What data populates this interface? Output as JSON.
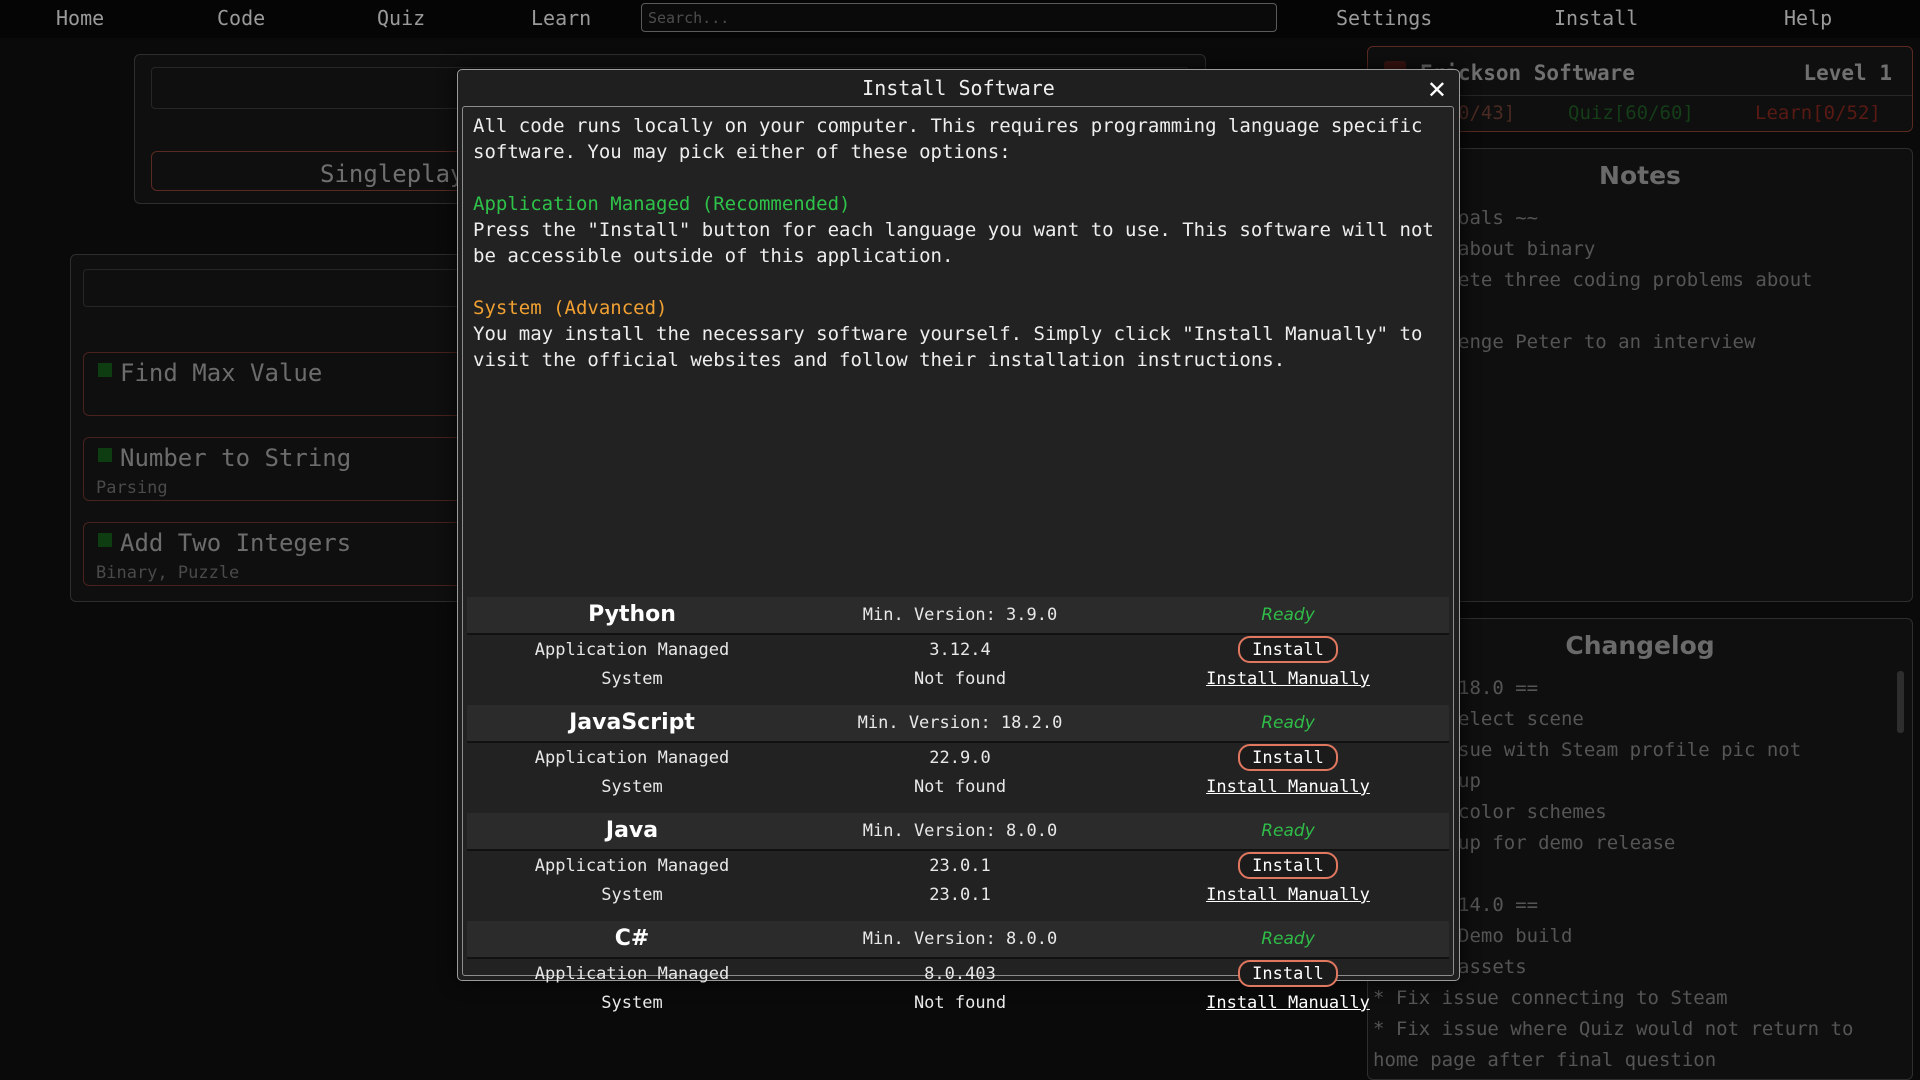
{
  "nav": {
    "home": "Home",
    "code": "Code",
    "quiz": "Quiz",
    "learn": "Learn",
    "search_placeholder": "Search...",
    "settings": "Settings",
    "install": "Install",
    "help": "Help"
  },
  "singleplayer": {
    "button_label": "Singleplay"
  },
  "challenges": [
    {
      "title": "Find Max Value",
      "tags": ""
    },
    {
      "title": "Number to String",
      "tags": "Parsing"
    },
    {
      "title": "Add Two Integers",
      "tags": "Binary, Puzzle"
    }
  ],
  "profile": {
    "name": "Erickson Software",
    "level": "Level 1",
    "stat_code": "0/43]",
    "stat_quiz": "Quiz[60/60]",
    "stat_learn": "Learn[0/52]"
  },
  "notes": {
    "title": "Notes",
    "lines": [
      "oals ~~",
      "about binary",
      "ete three coding problems about",
      "",
      "enge Peter to an interview"
    ]
  },
  "changelog": {
    "title": "Changelog",
    "lines": [
      "18.0 ==",
      "elect scene",
      "sue with Steam profile pic not",
      "up",
      " color schemes",
      "up for demo release",
      "",
      "14.0 ==",
      " Demo build",
      " assets"
    ],
    "full_lines": [
      "* Fix issue connecting to Steam",
      "* Fix issue where Quiz would not return to",
      "home page after final question"
    ]
  },
  "modal": {
    "title": "Install Software",
    "close": "✕",
    "intro_line1": "All code runs locally on your computer. This requires programming language specific",
    "intro_line2": "software. You may pick either of these options:",
    "managed_heading": "Application Managed (Recommended)",
    "managed_line1": "Press the \"Install\" button for each language you want to use. This software will not",
    "managed_line2": "be accessible outside of this application.",
    "system_heading": "System (Advanced)",
    "system_line1": "You may install the necessary software yourself. Simply click \"Install Manually\" to",
    "system_line2": "visit the official websites and follow their installation instructions.",
    "languages": [
      {
        "name": "Python",
        "min_version": "Min. Version: 3.9.0",
        "status": "Ready",
        "managed_label": "Application Managed",
        "managed_version": "3.12.4",
        "install_label": "Install",
        "system_label": "System",
        "system_version": "Not found",
        "manual_label": "Install Manually"
      },
      {
        "name": "JavaScript",
        "min_version": "Min. Version: 18.2.0",
        "status": "Ready",
        "managed_label": "Application Managed",
        "managed_version": "22.9.0",
        "install_label": "Install",
        "system_label": "System",
        "system_version": "Not found",
        "manual_label": "Install Manually"
      },
      {
        "name": "Java",
        "min_version": "Min. Version: 8.0.0",
        "status": "Ready",
        "managed_label": "Application Managed",
        "managed_version": "23.0.1",
        "install_label": "Install",
        "system_label": "System",
        "system_version": "23.0.1",
        "manual_label": "Install Manually"
      },
      {
        "name": "C#",
        "min_version": "Min. Version: 8.0.0",
        "status": "Ready",
        "managed_label": "Application Managed",
        "managed_version": "8.0.403",
        "install_label": "Install",
        "system_label": "System",
        "system_version": "Not found",
        "manual_label": "Install Manually"
      }
    ]
  },
  "colors": {
    "accent_ready": "#2fbd48",
    "heading_recommended": "#2fc24a",
    "heading_advanced": "#f0a032",
    "install_border": "#e07860"
  }
}
